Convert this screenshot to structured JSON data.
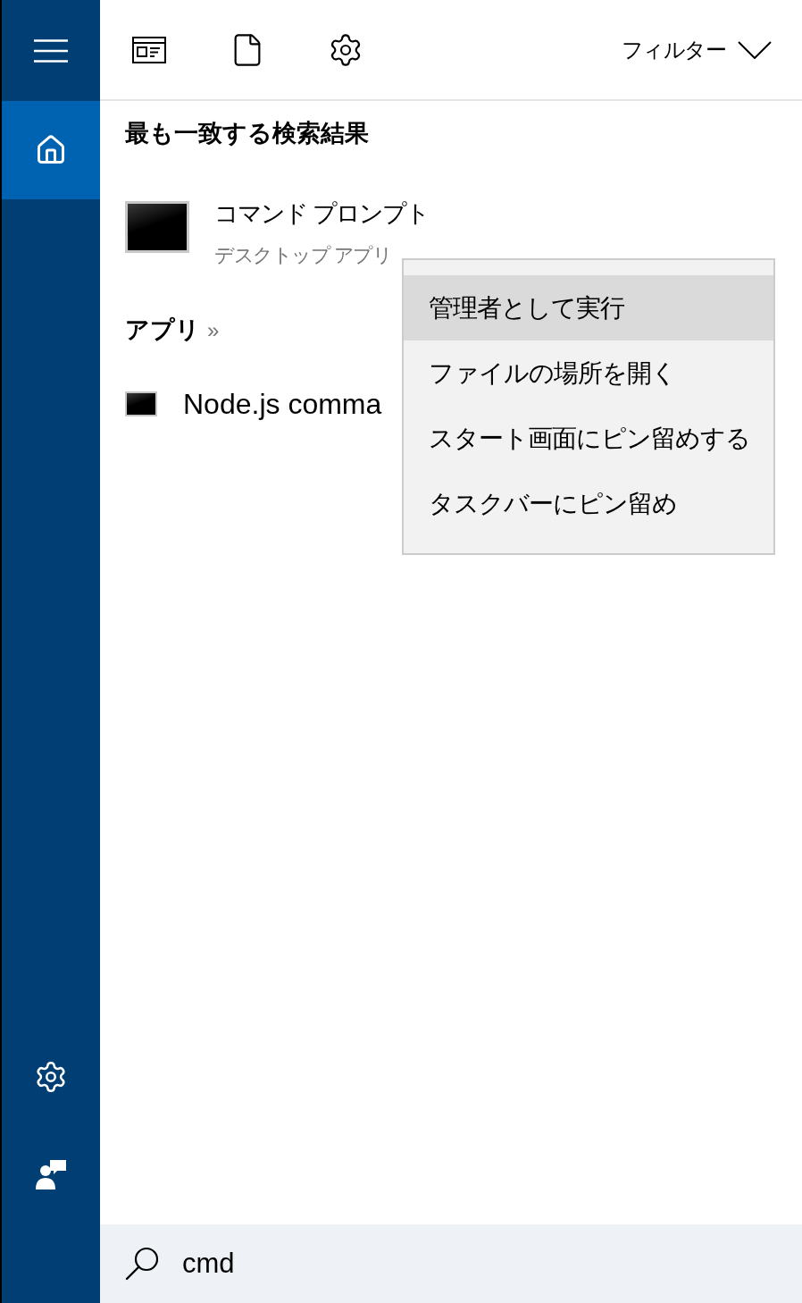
{
  "sidebar": {
    "top": [
      {
        "kind": "home",
        "selected": true
      }
    ],
    "bottom": [
      {
        "kind": "settings",
        "selected": false
      },
      {
        "kind": "feedback",
        "selected": false
      }
    ]
  },
  "toolbar": {
    "filter": {
      "label": "フィルター"
    }
  },
  "best_match": {
    "heading": "最も一致する検索結果",
    "title": "コマンド プロンプト",
    "subtitle": "デスクトップ アプリ"
  },
  "apps": {
    "heading": "アプリ",
    "more": "»",
    "items": [
      {
        "label": "Node.js comma"
      }
    ]
  },
  "context_menu": {
    "items": [
      {
        "label": "管理者として実行",
        "selected": true
      },
      {
        "label": "ファイルの場所を開く",
        "selected": false
      },
      {
        "label": "スタート画面にピン留めする",
        "selected": false
      },
      {
        "label": "タスクバーにピン留め",
        "selected": false
      }
    ]
  },
  "search": {
    "value": "cmd"
  }
}
